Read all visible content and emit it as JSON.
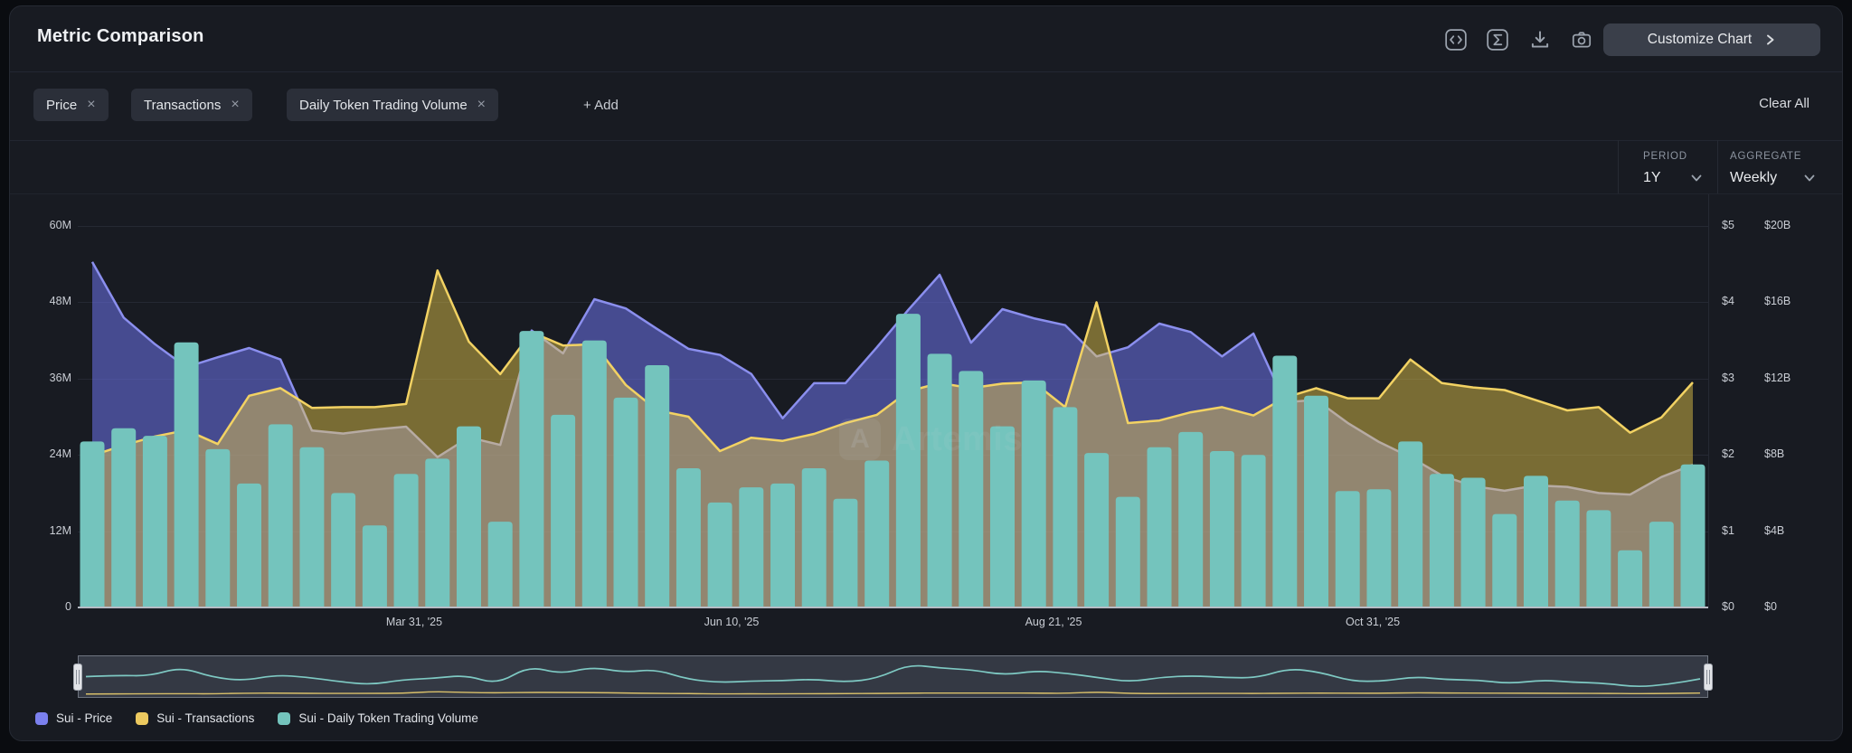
{
  "header": {
    "title": "Metric Comparison",
    "customize_label": "Customize Chart",
    "icons": [
      "embed-code-icon",
      "formula-icon",
      "download-icon",
      "screenshot-icon"
    ]
  },
  "filters": {
    "chips": [
      {
        "label": "Price"
      },
      {
        "label": "Transactions"
      },
      {
        "label": "Daily Token Trading Volume"
      }
    ],
    "remove_icon": "×",
    "add_label": "+ Add",
    "clear_all_label": "Clear All"
  },
  "controls": {
    "period_label": "PERIOD",
    "period_value": "1Y",
    "aggregate_label": "AGGREGATE",
    "aggregate_value": "Weekly"
  },
  "watermark": {
    "logo_letter": "A",
    "text": "Artemis"
  },
  "legend": {
    "items": [
      {
        "label": "Sui - Price",
        "color": "#7b80ee"
      },
      {
        "label": "Sui - Transactions",
        "color": "#ecc95f"
      },
      {
        "label": "Sui - Daily Token Trading Volume",
        "color": "#74c4bd"
      }
    ]
  },
  "chart_data": {
    "type": "combo (two overlaid areas + bar series, weekly points over 1 year)",
    "x_tick_labels": [
      "Mar 31, '25",
      "Jun 10, '25",
      "Aug 21, '25",
      "Oct 31, '25"
    ],
    "grid": "horizontal gridlines on",
    "legend_position": "bottom-left",
    "axes": {
      "left_transactions": {
        "ticks": [
          "60M",
          "48M",
          "36M",
          "24M",
          "12M",
          "0"
        ],
        "range": [
          0,
          60000000
        ]
      },
      "right_price_usd": {
        "ticks": [
          "$5",
          "$4",
          "$3",
          "$2",
          "$1",
          "$0"
        ],
        "range": [
          0,
          5
        ]
      },
      "right_volume_usd": {
        "ticks": [
          "$20B",
          "$16B",
          "$12B",
          "$8B",
          "$4B",
          "$0"
        ],
        "range": [
          0,
          20000000000
        ]
      }
    },
    "series": [
      {
        "name": "Sui - Price",
        "type": "area",
        "axis": "right_price_usd",
        "unit": "USD",
        "color": "#8b8fee",
        "fill": "rgba(110,115,235,0.55)",
        "values": [
          4.53,
          3.8,
          3.45,
          3.15,
          3.28,
          3.4,
          3.25,
          2.32,
          2.28,
          2.33,
          2.37,
          1.97,
          2.23,
          2.13,
          3.63,
          3.33,
          4.04,
          3.92,
          3.65,
          3.39,
          3.31,
          3.06,
          2.48,
          2.94,
          2.94,
          3.41,
          3.9,
          4.36,
          3.47,
          3.91,
          3.79,
          3.7,
          3.29,
          3.41,
          3.72,
          3.61,
          3.29,
          3.59,
          2.69,
          2.72,
          2.42,
          2.17,
          1.97,
          1.73,
          1.59,
          1.53,
          1.6,
          1.58,
          1.5,
          1.48,
          1.71,
          1.87
        ]
      },
      {
        "name": "Sui - Transactions",
        "type": "area",
        "axis": "left_transactions",
        "unit": "millions",
        "color": "#f2d263",
        "fill": "rgba(235,205,75,0.46)",
        "values": [
          23.9,
          25.5,
          26.9,
          27.9,
          25.7,
          33.3,
          34.5,
          31.4,
          31.5,
          31.5,
          32.0,
          53.0,
          41.8,
          36.7,
          43.3,
          41.2,
          41.4,
          35.0,
          31.0,
          30.0,
          24.6,
          26.7,
          26.2,
          27.3,
          29.0,
          30.3,
          34.0,
          35.3,
          34.5,
          35.2,
          35.4,
          31.5,
          48.0,
          29.0,
          29.4,
          30.7,
          31.5,
          30.2,
          33.0,
          34.5,
          32.9,
          32.9,
          39.0,
          35.3,
          34.6,
          34.2,
          32.6,
          31.0,
          31.5,
          27.5,
          29.9,
          35.4
        ]
      },
      {
        "name": "Sui - Daily Token Trading Volume",
        "type": "bar",
        "axis": "right_volume_usd",
        "unit": "USD billions",
        "color": "#74c4bd",
        "values": [
          8.7,
          9.4,
          9.0,
          13.9,
          8.3,
          6.5,
          9.6,
          8.4,
          6.0,
          4.3,
          7.0,
          7.8,
          9.5,
          4.5,
          14.5,
          10.1,
          14.0,
          11.0,
          12.7,
          7.3,
          5.5,
          6.3,
          6.5,
          7.3,
          5.7,
          7.7,
          15.4,
          13.3,
          12.4,
          9.5,
          11.9,
          10.5,
          8.1,
          5.8,
          8.4,
          9.2,
          8.2,
          8.0,
          13.2,
          11.1,
          6.1,
          6.2,
          8.7,
          7.0,
          6.8,
          4.9,
          6.9,
          5.6,
          5.1,
          3.0,
          4.5,
          7.5
        ]
      }
    ]
  }
}
